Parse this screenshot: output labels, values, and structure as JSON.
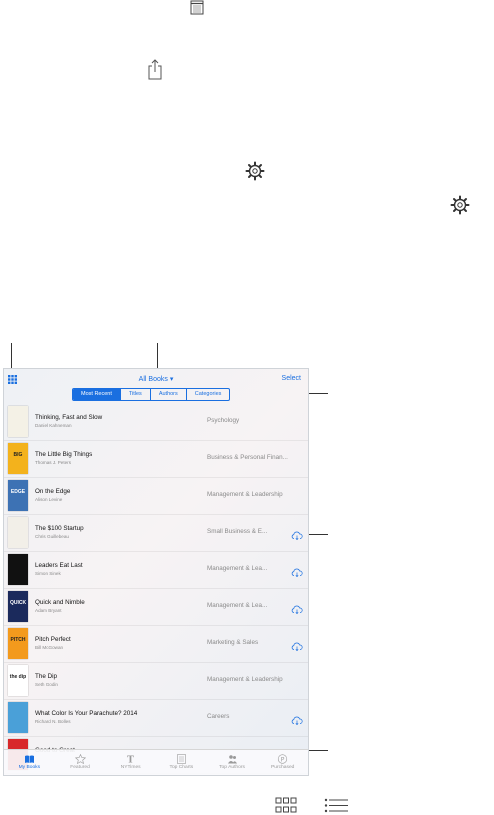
{
  "colors": {
    "accent": "#1a6fe0",
    "secondary_text": "#8a8a8a"
  },
  "legend_icons": [
    "table-of-contents-icon",
    "share-icon",
    "settings-gear-icon",
    "settings-gear-icon",
    "grid-view-icon",
    "list-view-icon"
  ],
  "header": {
    "grid_icon": "grid-icon",
    "title": "All Books",
    "title_arrow": "▾",
    "select_label": "Select"
  },
  "segments": [
    {
      "label": "Most Recent",
      "active": true
    },
    {
      "label": "Titles",
      "active": false
    },
    {
      "label": "Authors",
      "active": false
    },
    {
      "label": "Categories",
      "active": false
    }
  ],
  "books": [
    {
      "title": "Thinking, Fast and Slow",
      "author": "Daniel Kahneman",
      "category": "Psychology",
      "cloud": false,
      "cover_color": "#f4f1e6",
      "cover_text": ""
    },
    {
      "title": "The Little Big Things",
      "author": "Thomas J. Peters",
      "category": "Business & Personal Finan...",
      "cloud": false,
      "cover_color": "#f3b21c",
      "cover_text": "BIG"
    },
    {
      "title": "On the Edge",
      "author": "Alison Levine",
      "category": "Management & Leadership",
      "cloud": false,
      "cover_color": "#3d72b4",
      "cover_text": "EDGE"
    },
    {
      "title": "The $100 Startup",
      "author": "Chris Guillebeau",
      "category": "Small Business & E...",
      "cloud": true,
      "cover_color": "#f2efe8",
      "cover_text": ""
    },
    {
      "title": "Leaders Eat Last",
      "author": "Simon Sinek",
      "category": "Management & Lea...",
      "cloud": true,
      "cover_color": "#111111",
      "cover_text": ""
    },
    {
      "title": "Quick and Nimble",
      "author": "Adam Bryant",
      "category": "Management & Lea...",
      "cloud": true,
      "cover_color": "#1b2a5c",
      "cover_text": "QUICK"
    },
    {
      "title": "Pitch Perfect",
      "author": "Bill McGowan",
      "category": "Marketing & Sales",
      "cloud": true,
      "cover_color": "#f39a1d",
      "cover_text": "PITCH"
    },
    {
      "title": "The Dip",
      "author": "Seth Godin",
      "category": "Management & Leadership",
      "cloud": false,
      "cover_color": "#ffffff",
      "cover_text": "the dip"
    },
    {
      "title": "What Color Is Your Parachute? 2014",
      "author": "Richard N. Bolles",
      "category": "Careers",
      "cloud": true,
      "cover_color": "#4aa0d8",
      "cover_text": ""
    },
    {
      "title": "Good to Great",
      "author": "",
      "category": "",
      "cloud": false,
      "cover_color": "#d8282a",
      "cover_text": ""
    }
  ],
  "tabs": [
    {
      "label": "My Books",
      "icon": "book-icon",
      "active": true
    },
    {
      "label": "Featured",
      "icon": "star-icon",
      "active": false
    },
    {
      "label": "NYTimes",
      "icon": "nytimes-icon",
      "active": false
    },
    {
      "label": "Top Charts",
      "icon": "list-icon",
      "active": false
    },
    {
      "label": "Top Authors",
      "icon": "people-icon",
      "active": false
    },
    {
      "label": "Purchased",
      "icon": "purchased-icon",
      "active": false
    }
  ]
}
